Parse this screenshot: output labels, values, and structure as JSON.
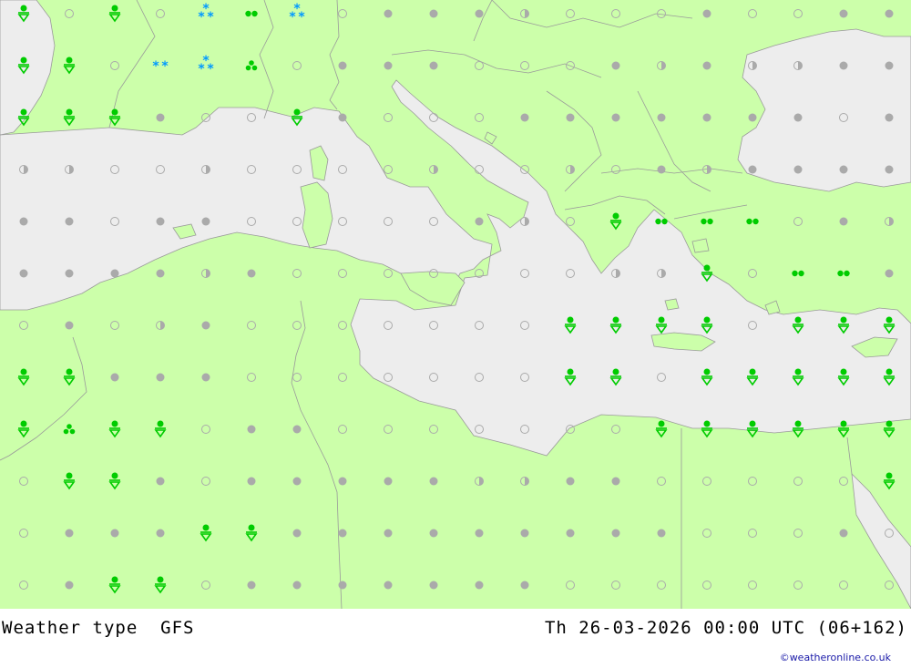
{
  "footer": {
    "left_label": "Weather type  GFS",
    "right_label": "Th 26-03-2026 00:00 UTC (06+162)",
    "credit": "©weatheronline.co.uk"
  },
  "colors": {
    "land": "#ccffaa",
    "sea": "#ededed",
    "border": "#9a9a9a",
    "rain": "#00cc00",
    "snow": "#0099ff",
    "cloud": "#aaaaaa"
  },
  "legend_symbols": {
    "c": "clear-sky-icon",
    "o": "overcast-icon",
    "p": "partly-cloudy-icon",
    "r": "rain-shower-icon",
    "d": "light-rain-icon",
    "t": "rain-cluster-icon",
    "s": "snow-icon",
    "w": "heavy-snow-icon"
  },
  "grid_rows": [
    "rcrcwdwcooopcccoccoo",
    "rrcswtcooocccopoppoo",
    "rrroccrocccoooooooco",
    "ppccpccccpccpcopoooo",
    "oocoocccccopcrdddcop",
    "oooopocccccccpprcddo",
    "cocpocccccccrrrrcrrr",
    "rrooocccccccrrcrrrrr",
    "rtrrcoocccccccrrrrrr",
    "crrocoooooppoocccccr",
    "cooorrooooooooocccoc",
    "corrcooooooocccccccc"
  ]
}
